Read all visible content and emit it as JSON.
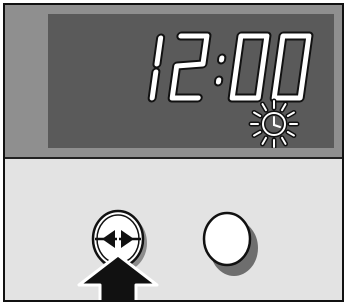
{
  "display": {
    "time": "12:00",
    "indicator_icon": "clock-icon",
    "indicator_state": "flashing"
  },
  "controls": {
    "select_button_icon": "left-right-arrows-icon",
    "select_button_highlighted": true,
    "second_button_icon": "none"
  },
  "pointer": {
    "icon": "up-arrow-icon",
    "target": "select-button"
  },
  "colors": {
    "panel_dark": "#8f8f8f",
    "lcd_background": "#5a5a5a",
    "segment": "#ffffff",
    "panel_light": "#e3e3e3"
  }
}
